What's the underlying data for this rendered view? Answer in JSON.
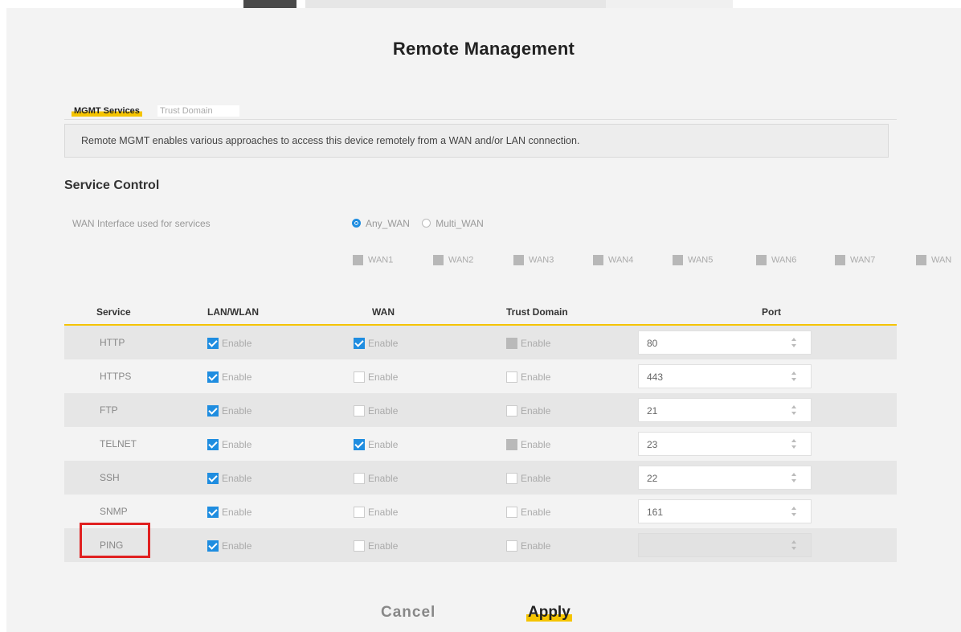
{
  "page": {
    "title": "Remote Management"
  },
  "tabs": [
    {
      "label": "MGMT Services"
    },
    {
      "label": "Trust Domain"
    }
  ],
  "description": "Remote MGMT enables various approaches to access this device remotely from a WAN and/or LAN connection.",
  "service_control": {
    "title": "Service Control",
    "wan_interface_label": "WAN Interface used for services",
    "wan_options": [
      {
        "label": "Any_WAN",
        "selected": true
      },
      {
        "label": "Multi_WAN",
        "selected": false
      }
    ],
    "wan_interfaces": [
      "WAN1",
      "WAN2",
      "WAN3",
      "WAN4",
      "WAN5",
      "WAN6",
      "WAN7",
      "WAN"
    ]
  },
  "table": {
    "headers": {
      "service": "Service",
      "lan": "LAN/WLAN",
      "wan": "WAN",
      "trust": "Trust Domain",
      "port": "Port"
    },
    "enable_label": "Enable",
    "rows": [
      {
        "service": "HTTP",
        "lan": "checked",
        "wan": "checked",
        "trust": "disabled",
        "port": "80"
      },
      {
        "service": "HTTPS",
        "lan": "checked",
        "wan": "empty",
        "trust": "empty",
        "port": "443"
      },
      {
        "service": "FTP",
        "lan": "checked",
        "wan": "empty",
        "trust": "empty",
        "port": "21"
      },
      {
        "service": "TELNET",
        "lan": "checked",
        "wan": "checked",
        "trust": "disabled",
        "port": "23"
      },
      {
        "service": "SSH",
        "lan": "checked",
        "wan": "empty",
        "trust": "empty",
        "port": "22"
      },
      {
        "service": "SNMP",
        "lan": "checked",
        "wan": "empty",
        "trust": "empty",
        "port": "161"
      },
      {
        "service": "PING",
        "lan": "checked",
        "wan": "empty",
        "trust": "empty",
        "port": ""
      }
    ]
  },
  "buttons": {
    "cancel": "Cancel",
    "apply": "Apply"
  },
  "colors": {
    "accent": "#f5c400",
    "checkbox": "#1f8de0",
    "highlight": "#e02020"
  }
}
